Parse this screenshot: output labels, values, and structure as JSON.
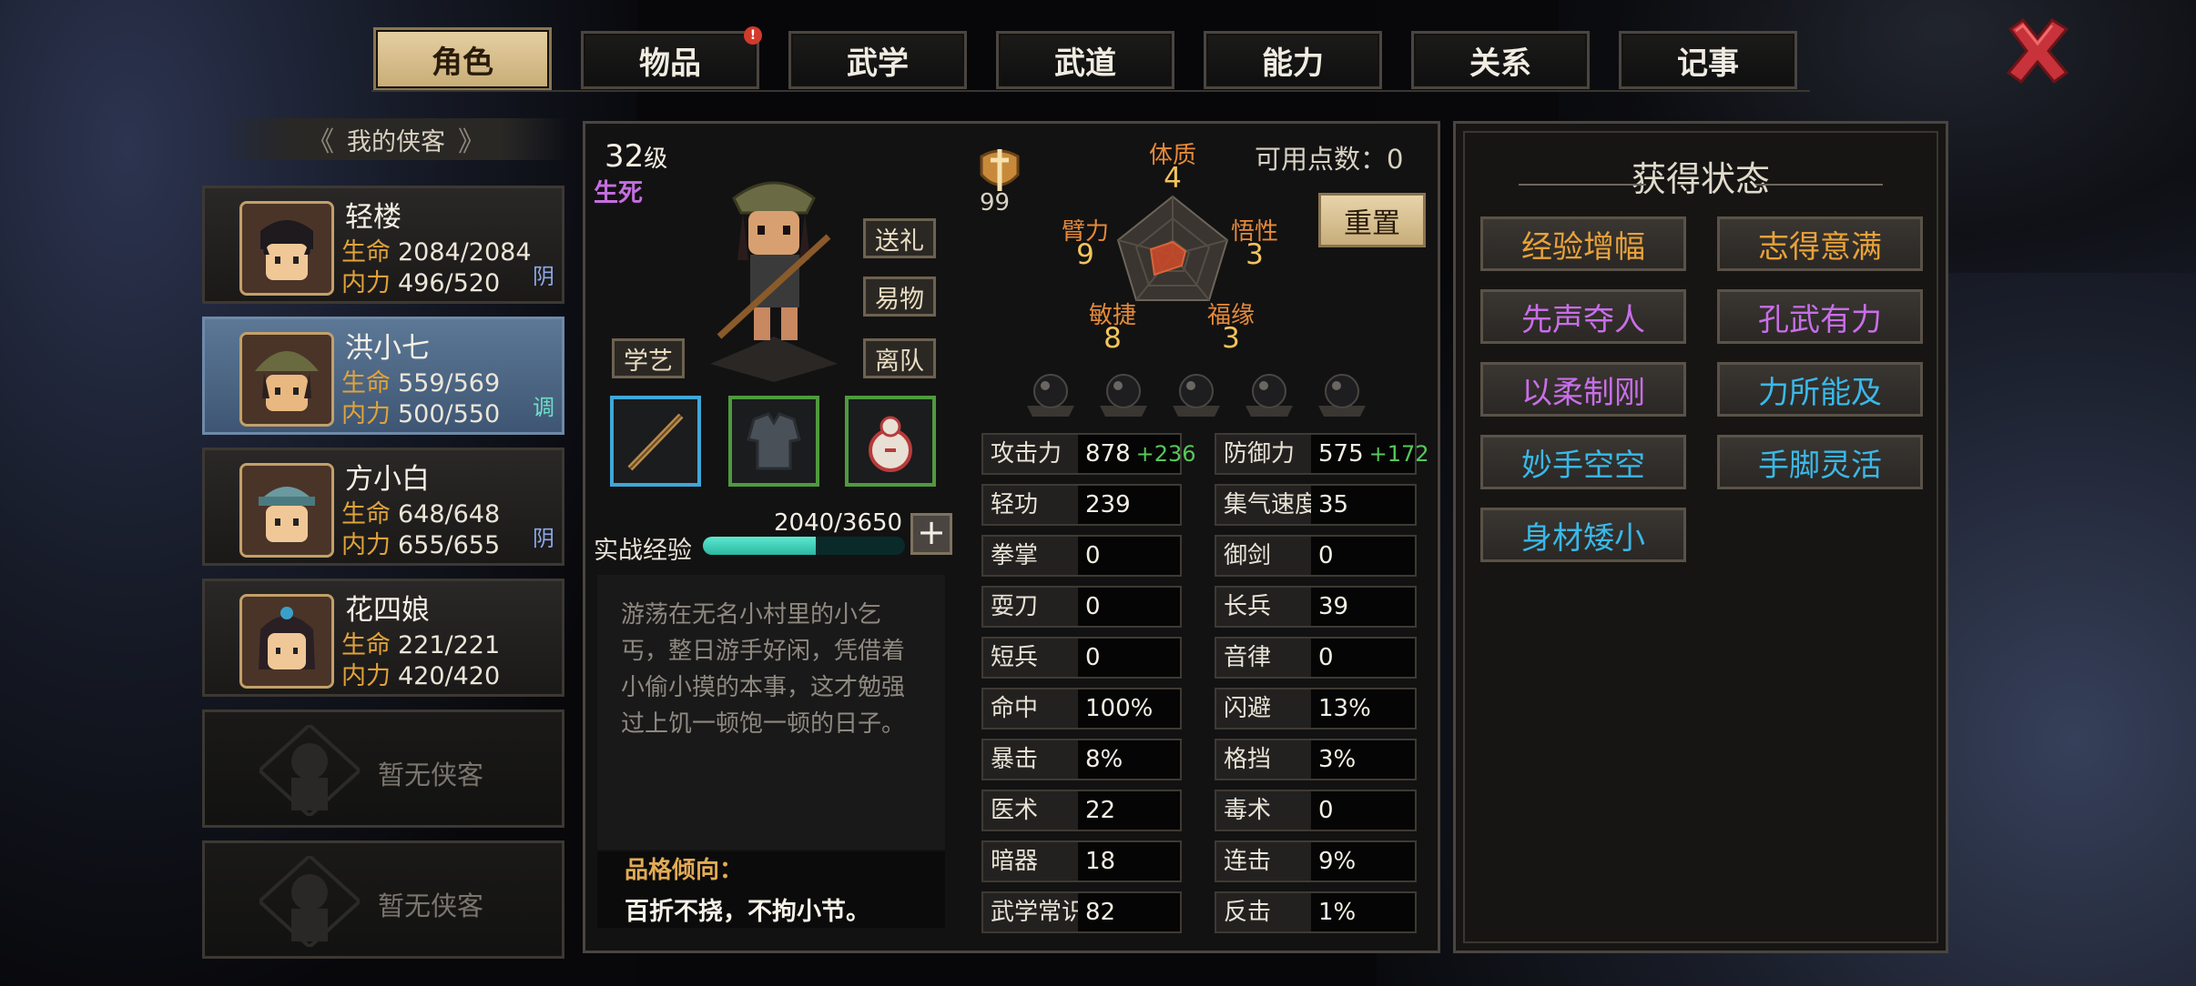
{
  "tabs": [
    {
      "label": "角色",
      "active": true
    },
    {
      "label": "物品",
      "badge": "!"
    },
    {
      "label": "武学"
    },
    {
      "label": "武道"
    },
    {
      "label": "能力"
    },
    {
      "label": "关系"
    },
    {
      "label": "记事"
    }
  ],
  "list": {
    "header": "我的侠客",
    "characters": [
      {
        "name": "轻楼",
        "hp_label": "生命",
        "hp": "2084/2084",
        "mp_label": "内力",
        "mp": "496/520",
        "tag": "阴",
        "tag_color": "#8da8e8"
      },
      {
        "name": "洪小七",
        "hp_label": "生命",
        "hp": "559/569",
        "mp_label": "内力",
        "mp": "500/550",
        "tag": "调",
        "tag_color": "#6ee0c8",
        "selected": true
      },
      {
        "name": "方小白",
        "hp_label": "生命",
        "hp": "648/648",
        "mp_label": "内力",
        "mp": "655/655",
        "tag": "阴",
        "tag_color": "#8da8e8"
      },
      {
        "name": "花四娘",
        "hp_label": "生命",
        "hp": "221/221",
        "mp_label": "内力",
        "mp": "420/420"
      }
    ],
    "empty_label": "暂无侠客"
  },
  "main": {
    "level_num": "32",
    "level_unit": "级",
    "life_death": "生死",
    "buttons": {
      "gift": "送礼",
      "trade": "易物",
      "leave": "离队",
      "learn": "学艺"
    },
    "exp_label": "实战经验",
    "exp_value": "2040/3650",
    "exp_fraction": 0.559,
    "plus": "+",
    "description": "游荡在无名小村里的小乞丐，整日游手好闲，凭借着小偷小摸的本事，这才勉强过上饥一顿饱一顿的日子。",
    "trait_title": "品格倾向：",
    "trait_text": "百折不挠，不拘小节。"
  },
  "attributes": {
    "medal_value": "99",
    "points_label": "可用点数：0",
    "reset": "重置",
    "labels": {
      "ti": "体质",
      "wu": "悟性",
      "fu": "福缘",
      "min": "敏捷",
      "bi": "臂力"
    },
    "values": {
      "ti": "4",
      "wu": "3",
      "fu": "3",
      "min": "8",
      "bi": "9"
    }
  },
  "stats_left": [
    {
      "label": "攻击力",
      "value": "878",
      "bonus": "+236"
    },
    {
      "label": "轻功",
      "value": "239"
    },
    {
      "label": "拳掌",
      "value": "0"
    },
    {
      "label": "耍刀",
      "value": "0"
    },
    {
      "label": "短兵",
      "value": "0"
    },
    {
      "label": "命中",
      "value": "100%"
    },
    {
      "label": "暴击",
      "value": "8%"
    },
    {
      "label": "医术",
      "value": "22"
    },
    {
      "label": "暗器",
      "value": "18"
    },
    {
      "label": "武学常识",
      "value": "82"
    }
  ],
  "stats_right": [
    {
      "label": "防御力",
      "value": "575",
      "bonus": "+172"
    },
    {
      "label": "集气速度",
      "value": "35"
    },
    {
      "label": "御剑",
      "value": "0"
    },
    {
      "label": "长兵",
      "value": "39"
    },
    {
      "label": "音律",
      "value": "0"
    },
    {
      "label": "闪避",
      "value": "13%"
    },
    {
      "label": "格挡",
      "value": "3%"
    },
    {
      "label": "毒术",
      "value": "0"
    },
    {
      "label": "连击",
      "value": "9%"
    },
    {
      "label": "反击",
      "value": "1%"
    }
  ],
  "status_panel": {
    "title": "获得状态",
    "items": [
      {
        "label": "经验增幅",
        "color": "#e8a23a"
      },
      {
        "label": "志得意满",
        "color": "#e8a23a"
      },
      {
        "label": "先声夺人",
        "color": "#c86ee8"
      },
      {
        "label": "孔武有力",
        "color": "#c86ee8"
      },
      {
        "label": "以柔制刚",
        "color": "#c86ee8"
      },
      {
        "label": "力所能及",
        "color": "#3ab8e8"
      },
      {
        "label": "妙手空空",
        "color": "#3ab8e8"
      },
      {
        "label": "手脚灵活",
        "color": "#3ab8e8"
      },
      {
        "label": "身材矮小",
        "color": "#3ab8e8"
      }
    ]
  },
  "icons": {
    "close": "close-x-icon",
    "medal": "sword-medal-icon",
    "slot": "skill-slot-orb-icon"
  }
}
